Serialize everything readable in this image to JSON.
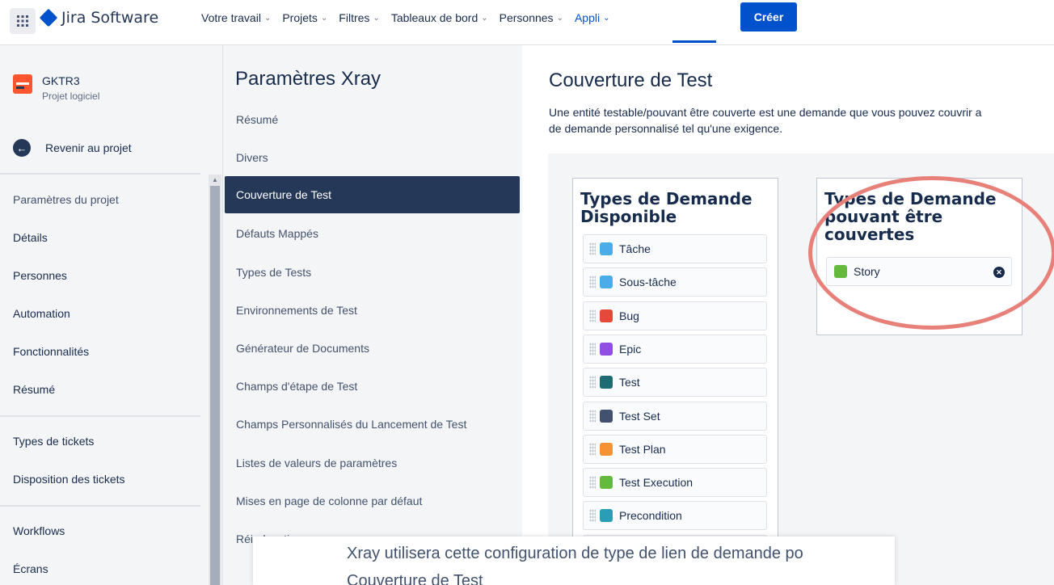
{
  "nav": {
    "logo_text": "Jira Software",
    "items": [
      {
        "label": "Votre travail",
        "active": false
      },
      {
        "label": "Projets",
        "active": false
      },
      {
        "label": "Filtres",
        "active": false
      },
      {
        "label": "Tableaux de bord",
        "active": false
      },
      {
        "label": "Personnes",
        "active": false
      },
      {
        "label": "Appli",
        "active": true
      }
    ],
    "create_label": "Créer",
    "accent": "#0052cc"
  },
  "sidebar": {
    "project_name": "GKTR3",
    "project_type": "Projet logiciel",
    "back_label": "Revenir au projet",
    "section_title": "Paramètres du projet",
    "items": [
      "Détails",
      "Personnes",
      "Automation",
      "Fonctionnalités",
      "Résumé"
    ],
    "items2": [
      "Types de tickets",
      "Disposition des tickets"
    ],
    "items3": [
      "Workflows",
      "Écrans"
    ]
  },
  "xray": {
    "title": "Paramètres Xray",
    "items": [
      "Résumé",
      "Divers",
      "Couverture de Test",
      "Défauts Mappés",
      "Types de Tests",
      "Environnements de Test",
      "Générateur de Documents",
      "Champs d'étape de Test",
      "Champs Personnalisés du Lancement de Test",
      "Listes de valeurs de paramètres",
      "Mises en page de colonne par défaut",
      "Réindexation"
    ],
    "selected_index": 2
  },
  "main": {
    "title": "Couverture de Test",
    "desc_line1": "Une entité testable/pouvant être couverte est une demande que vous pouvez couvrir a",
    "desc_line2": "de demande personnalisé tel qu'une exigence.",
    "available_title_1": "Types de Demande",
    "available_title_2": "Disponible",
    "available": [
      {
        "label": "Tâche",
        "color": "#4bade8",
        "icon": "checkbox-icon"
      },
      {
        "label": "Sous-tâche",
        "color": "#4bade8",
        "icon": "subtask-icon"
      },
      {
        "label": "Bug",
        "color": "#e5493a",
        "icon": "bug-icon"
      },
      {
        "label": "Epic",
        "color": "#904ee2",
        "icon": "epic-icon"
      },
      {
        "label": "Test",
        "color": "#1e6b73",
        "icon": "test-icon"
      },
      {
        "label": "Test Set",
        "color": "#42526e",
        "icon": "test-set-icon"
      },
      {
        "label": "Test Plan",
        "color": "#f79232",
        "icon": "test-plan-icon"
      },
      {
        "label": "Test Execution",
        "color": "#63ba3c",
        "icon": "test-execution-icon"
      },
      {
        "label": "Precondition",
        "color": "#2a9db7",
        "icon": "precondition-icon"
      }
    ],
    "covered_title_1": "Types de Demande",
    "covered_title_2": "pouvant être",
    "covered_title_3": "couvertes",
    "covered": [
      {
        "label": "Story",
        "color": "#63ba3c",
        "icon": "story-icon"
      }
    ]
  },
  "overlay": {
    "line1": "Xray utilisera cette configuration de type de lien de demande po",
    "line2": "Couverture de Test"
  }
}
